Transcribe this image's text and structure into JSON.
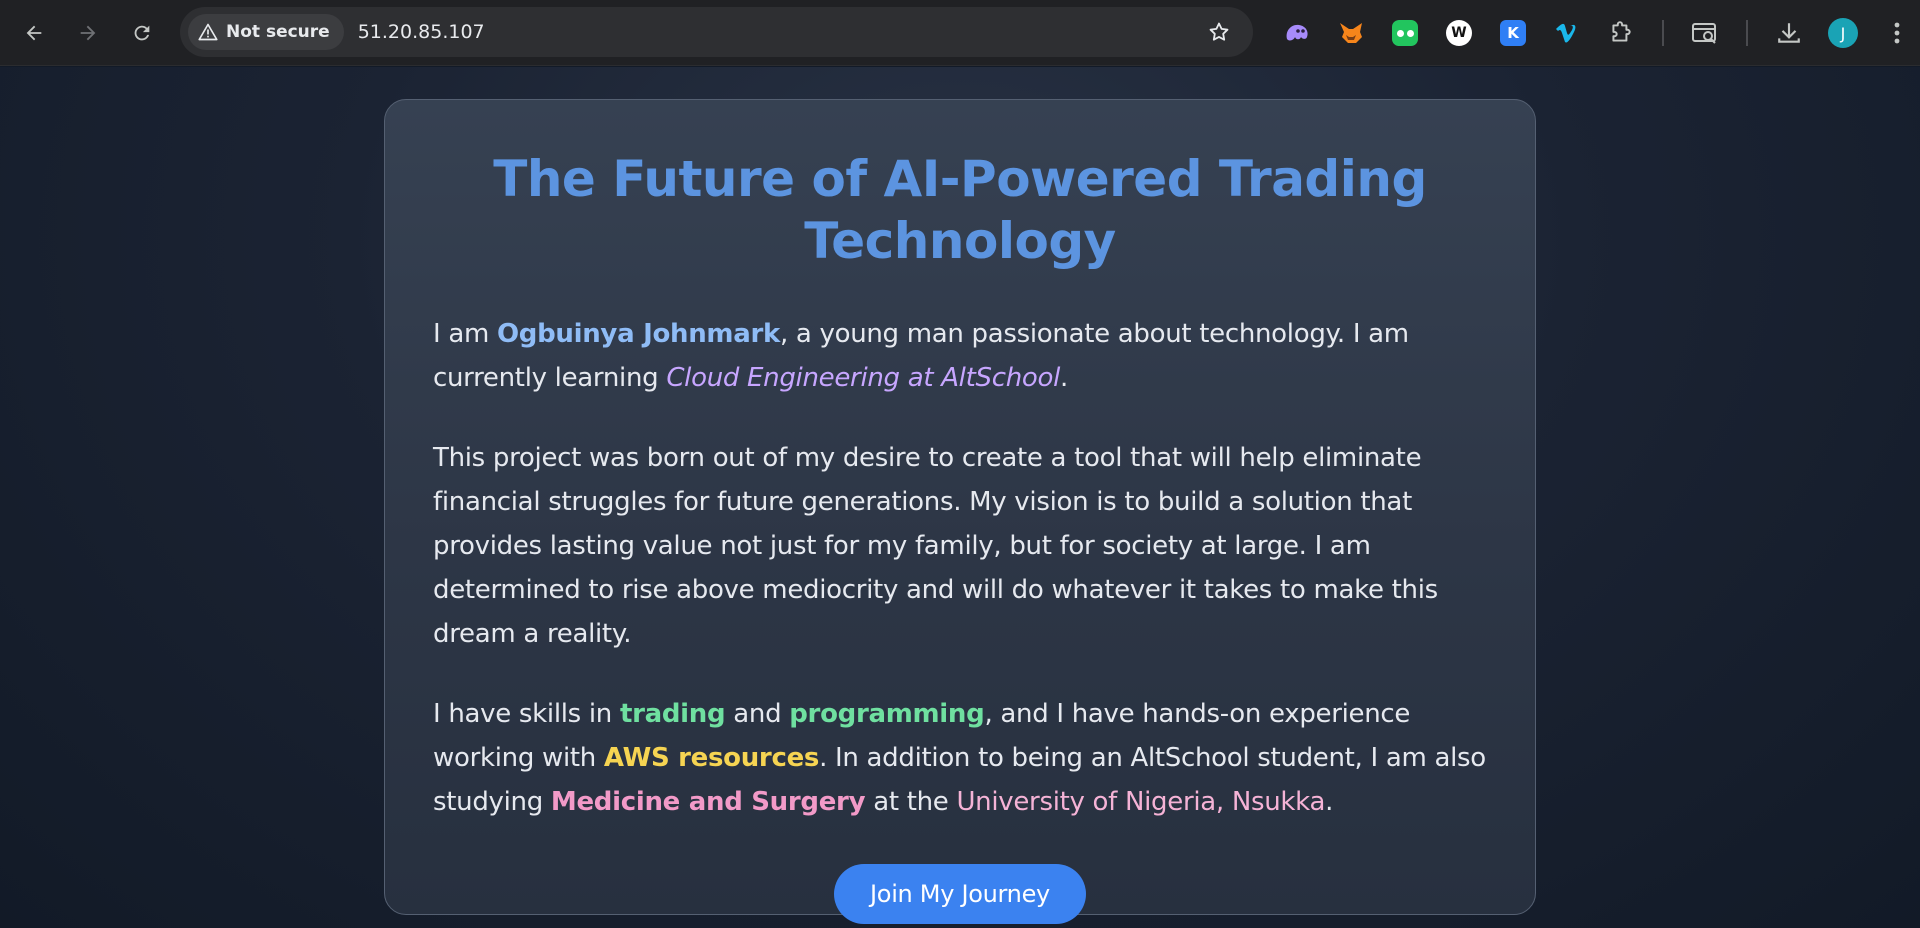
{
  "browser": {
    "security_label": "Not secure",
    "url": "51.20.85.107",
    "avatar_initial": "J",
    "extensions": [
      {
        "icon": "ghost-extension-icon",
        "color": "#a78bfa"
      },
      {
        "icon": "fox-wallet-extension-icon",
        "color": "#f6851b"
      },
      {
        "icon": "frog-extension-icon",
        "color": "#22c55e"
      },
      {
        "icon": "w-extension-icon",
        "color": "#ffffff"
      },
      {
        "icon": "k-extension-icon",
        "color": "#2f7ff5"
      },
      {
        "icon": "vimeo-extension-icon",
        "color": "#1ab7ea"
      }
    ]
  },
  "page": {
    "title": "The Future of AI-Powered Trading Technology",
    "intro": {
      "prefix": "I am ",
      "name": "Ogbuinya Johnmark",
      "middle": ", a young man passionate about technology. I am currently learning ",
      "school": "Cloud Engineering at AltSchool",
      "suffix": "."
    },
    "mission": "This project was born out of my desire to create a tool that will help eliminate financial struggles for future generations. My vision is to build a solution that provides lasting value not just for my family, but for society at large. I am determined to rise above mediocrity and will do whatever it takes to make this dream a reality.",
    "skills": {
      "prefix": "I have skills in ",
      "skill1": "trading",
      "and": " and ",
      "skill2": "programming",
      "middle": ", and I have hands-on experience working with ",
      "aws": "AWS resources",
      "middle2": ". In addition to being an AltSchool student, I am also studying ",
      "course": "Medicine and Surgery",
      "at": " at the ",
      "university": "University of Nigeria, Nsukka",
      "suffix": "."
    },
    "cta_label": "Join My Journey"
  }
}
